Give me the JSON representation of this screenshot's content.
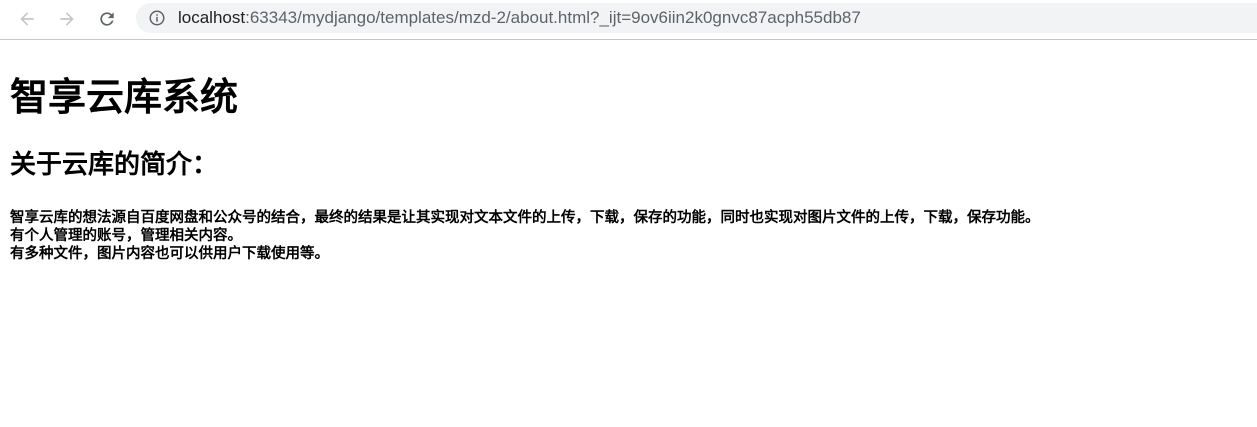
{
  "browser": {
    "back_icon": "arrow-left-icon",
    "forward_icon": "arrow-right-icon",
    "reload_icon": "reload-icon",
    "info_icon": "info-circle-icon",
    "url_host": "localhost",
    "url_rest": ":63343/mydjango/templates/mzd-2/about.html?_ijt=9ov6iin2k0gnvc87acph55db87"
  },
  "page": {
    "title": "智享云库系统",
    "subtitle": "关于云库的简介：",
    "lines": [
      "智享云库的想法源自百度网盘和公众号的结合，最终的结果是让其实现对文本文件的上传，下载，保存的功能，同时也实现对图片文件的上传，下载，保存功能。",
      "有个人管理的账号，管理相关内容。",
      "有多种文件，图片内容也可以供用户下载使用等。"
    ]
  },
  "colors": {
    "omnibox_bg": "#f1f3f4",
    "icon_gray": "#5f6368",
    "text": "#000000"
  }
}
